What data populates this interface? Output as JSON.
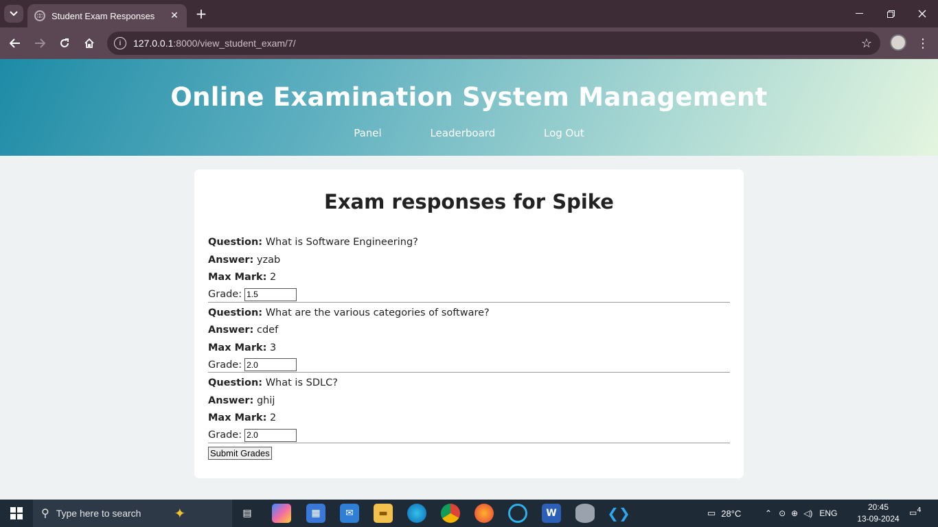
{
  "browser": {
    "tab_title": "Student Exam Responses",
    "url_host": "127.0.0.1",
    "url_path": ":8000/view_student_exam/7/"
  },
  "header": {
    "title": "Online Examination System Management",
    "nav": [
      "Panel",
      "Leaderboard",
      "Log Out"
    ]
  },
  "main": {
    "heading": "Exam responses for Spike",
    "labels": {
      "question": "Question:",
      "answer": "Answer:",
      "max_mark": "Max Mark:",
      "grade": "Grade:"
    },
    "responses": [
      {
        "question": "What is Software Engineering?",
        "answer": "yzab",
        "max_mark": "2",
        "grade": "1.5"
      },
      {
        "question": "What are the various categories of software?",
        "answer": "cdef",
        "max_mark": "3",
        "grade": "2.0"
      },
      {
        "question": "What is SDLC?",
        "answer": "ghij",
        "max_mark": "2",
        "grade": "2.0"
      }
    ],
    "submit_label": "Submit Grades"
  },
  "taskbar": {
    "search_placeholder": "Type here to search",
    "weather": "28°C",
    "language": "ENG",
    "time": "20:45",
    "date": "13-09-2024",
    "notification_count": "4"
  },
  "colors": {
    "header_gradient_start": "#1e8ba6",
    "header_gradient_end": "#e4f5df",
    "page_bg": "#eef2f2",
    "browser_frame": "#3d2b36"
  }
}
